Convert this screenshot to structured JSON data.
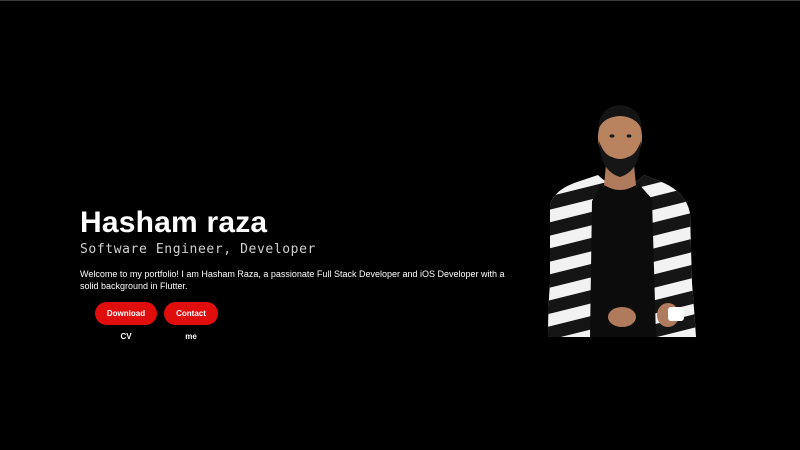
{
  "hero": {
    "name": "Hasham raza",
    "role": "Software Engineer, Developer",
    "intro": "Welcome to my portfolio! I am Hasham Raza, a passionate Full Stack Developer and iOS Developer with a solid background in Flutter."
  },
  "buttons": {
    "download_cv": "Download CV",
    "contact": "Contact me"
  },
  "colors": {
    "background": "#000000",
    "accent": "#e00d0d",
    "text": "#ffffff"
  }
}
